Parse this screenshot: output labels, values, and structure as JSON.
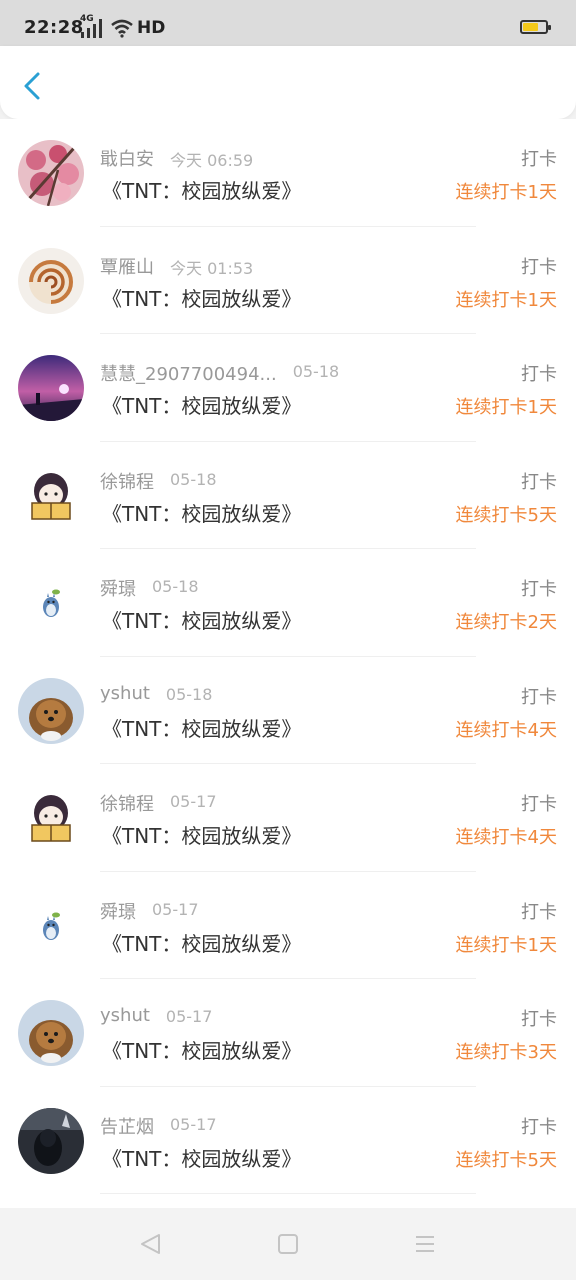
{
  "status_bar": {
    "time": "22:28",
    "network": "4G",
    "hd": "HD",
    "battery_level": 0.7,
    "battery_color": "#f3c81a"
  },
  "header": {
    "back_icon": "chevron-left-icon",
    "accent_color": "#2aa0d4"
  },
  "list": {
    "items": [
      {
        "user": "戢白安",
        "date": "今天 06:59",
        "title": "《TNT：校园放纵爱》",
        "type": "打卡",
        "streak": "连续打卡1天",
        "avatar": "cherry-blossom"
      },
      {
        "user": "覃雁山",
        "date": "今天 01:53",
        "title": "《TNT：校园放纵爱》",
        "type": "打卡",
        "streak": "连续打卡1天",
        "avatar": "seashell"
      },
      {
        "user": "慧慧_2907700494...",
        "date": "05-18",
        "title": "《TNT：校园放纵爱》",
        "type": "打卡",
        "streak": "连续打卡1天",
        "avatar": "purple-sky"
      },
      {
        "user": "徐锦程",
        "date": "05-18",
        "title": "《TNT：校园放纵爱》",
        "type": "打卡",
        "streak": "连续打卡5天",
        "avatar": "cartoon-reader"
      },
      {
        "user": "舜璟",
        "date": "05-18",
        "title": "《TNT：校园放纵爱》",
        "type": "打卡",
        "streak": "连续打卡2天",
        "avatar": "totoro"
      },
      {
        "user": "yshut",
        "date": "05-18",
        "title": "《TNT：校园放纵爱》",
        "type": "打卡",
        "streak": "连续打卡4天",
        "avatar": "pomeranian"
      },
      {
        "user": "徐锦程",
        "date": "05-17",
        "title": "《TNT：校园放纵爱》",
        "type": "打卡",
        "streak": "连续打卡4天",
        "avatar": "cartoon-reader"
      },
      {
        "user": "舜璟",
        "date": "05-17",
        "title": "《TNT：校园放纵爱》",
        "type": "打卡",
        "streak": "连续打卡1天",
        "avatar": "totoro"
      },
      {
        "user": "yshut",
        "date": "05-17",
        "title": "《TNT：校园放纵爱》",
        "type": "打卡",
        "streak": "连续打卡3天",
        "avatar": "pomeranian"
      },
      {
        "user": "告芷烟",
        "date": "05-17",
        "title": "《TNT：校园放纵爱》",
        "type": "打卡",
        "streak": "连续打卡5天",
        "avatar": "dark-portrait"
      }
    ]
  },
  "nav_bar": {
    "back_icon": "triangle-back-icon",
    "home_icon": "square-home-icon",
    "menu_icon": "menu-lines-icon"
  },
  "colors": {
    "streak": "#f0883c",
    "username": "#999999",
    "title": "#333333"
  }
}
